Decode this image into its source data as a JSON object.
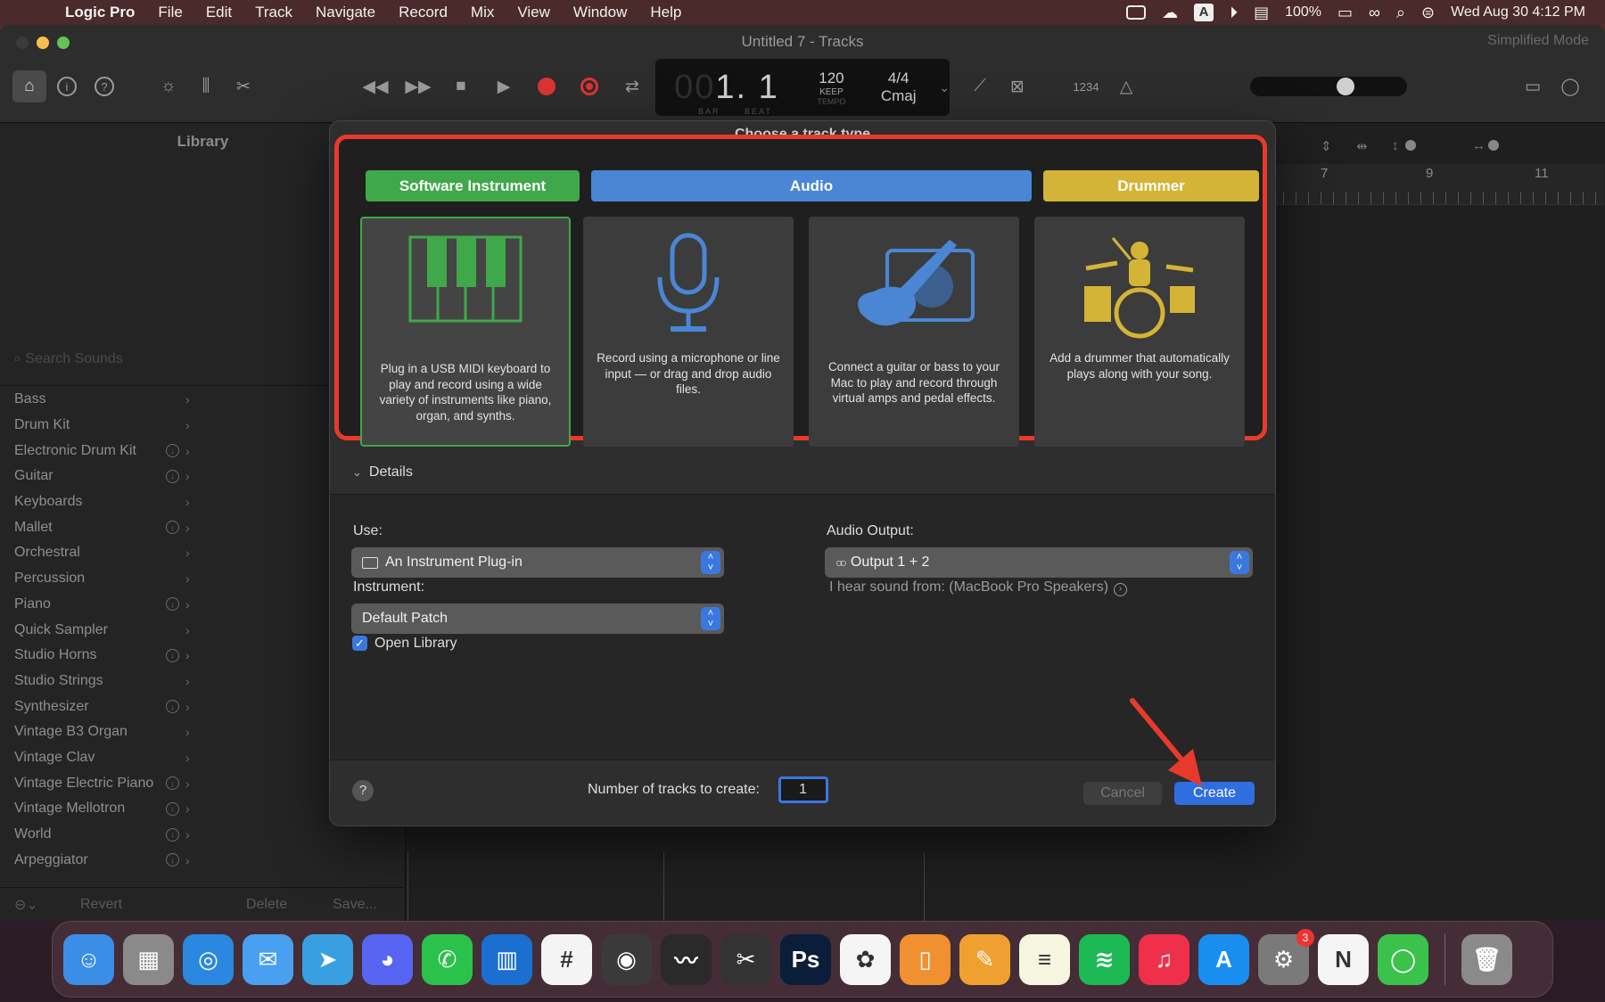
{
  "menubar": {
    "app_name": "Logic Pro",
    "items": [
      "File",
      "Edit",
      "Track",
      "Navigate",
      "Record",
      "Mix",
      "View",
      "Window",
      "Help"
    ],
    "input_source": "A",
    "battery": "100%",
    "datetime": "Wed Aug 30  4:12 PM"
  },
  "window": {
    "title": "Untitled 7 - Tracks",
    "simplified_mode": "Simplified Mode"
  },
  "lcd": {
    "position_dim": "00",
    "position": "1. 1",
    "bar_label": "BAR",
    "beat_label": "BEAT",
    "tempo": "120",
    "tempo_mode": "KEEP",
    "tempo_label": "TEMPO",
    "time_signature": "4/4",
    "key": "Cmaj"
  },
  "toolbar": {
    "count_in": "1234",
    "master_volume": 0.62
  },
  "library": {
    "title": "Library",
    "search_placeholder": "Search Sounds",
    "items": [
      {
        "label": "Bass",
        "download": false
      },
      {
        "label": "Drum Kit",
        "download": false
      },
      {
        "label": "Electronic Drum Kit",
        "download": true
      },
      {
        "label": "Guitar",
        "download": true
      },
      {
        "label": "Keyboards",
        "download": false
      },
      {
        "label": "Mallet",
        "download": true
      },
      {
        "label": "Orchestral",
        "download": false
      },
      {
        "label": "Percussion",
        "download": false
      },
      {
        "label": "Piano",
        "download": true
      },
      {
        "label": "Quick Sampler",
        "download": false
      },
      {
        "label": "Studio Horns",
        "download": true
      },
      {
        "label": "Studio Strings",
        "download": false
      },
      {
        "label": "Synthesizer",
        "download": true
      },
      {
        "label": "Vintage B3 Organ",
        "download": false
      },
      {
        "label": "Vintage Clav",
        "download": false
      },
      {
        "label": "Vintage Electric Piano",
        "download": true
      },
      {
        "label": "Vintage Mellotron",
        "download": true
      },
      {
        "label": "World",
        "download": true
      },
      {
        "label": "Arpeggiator",
        "download": true
      }
    ],
    "footer": {
      "revert": "Revert",
      "delete": "Delete",
      "save": "Save..."
    }
  },
  "ruler": {
    "marks": [
      "7",
      "9",
      "11"
    ]
  },
  "dialog": {
    "title": "Choose a track type",
    "tabs": {
      "software_instrument": "Software Instrument",
      "audio": "Audio",
      "drummer": "Drummer"
    },
    "cards": {
      "software_instrument": "Plug in a USB MIDI keyboard to play and record using a wide variety of instruments like piano, organ, and synths.",
      "microphone": "Record using a microphone or line input — or drag and drop audio files.",
      "guitar": "Connect a guitar or bass to your Mac to play and record through virtual amps and pedal effects.",
      "drummer": "Add a drummer that automatically plays along with your song."
    },
    "details_label": "Details",
    "use_label": "Use:",
    "use_value": "An Instrument Plug-in",
    "instrument_label": "Instrument:",
    "instrument_value": "Default Patch",
    "open_library_label": "Open Library",
    "open_library_checked": true,
    "audio_output_label": "Audio Output:",
    "audio_output_value": "Output 1 + 2",
    "hear_sound": "I hear sound from: (MacBook Pro Speakers)",
    "num_tracks_label": "Number of tracks to create:",
    "num_tracks_value": "1",
    "cancel_label": "Cancel",
    "create_label": "Create"
  },
  "colors": {
    "software_instrument": "#3fa84a",
    "audio": "#4a86d4",
    "drummer": "#d4b436",
    "highlight": "#e83a2c",
    "accent": "#2f6ee0"
  },
  "dock": {
    "items": [
      {
        "name": "Finder",
        "glyph": "☺",
        "color": "#3a8ee6"
      },
      {
        "name": "Launchpad",
        "glyph": "▦",
        "color": "#8a8a8a"
      },
      {
        "name": "Safari",
        "glyph": "◎",
        "color": "#2a88e0"
      },
      {
        "name": "Mail",
        "glyph": "✉",
        "color": "#4aa0f0"
      },
      {
        "name": "Telegram",
        "glyph": "➤",
        "color": "#38a0e0"
      },
      {
        "name": "Discord",
        "glyph": "◕",
        "color": "#5865f2"
      },
      {
        "name": "WhatsApp",
        "glyph": "✆",
        "color": "#2ac24a"
      },
      {
        "name": "Trello",
        "glyph": "▥",
        "color": "#1a6fd0"
      },
      {
        "name": "Slack",
        "glyph": "#",
        "color": "#f4f4f4"
      },
      {
        "name": "Logic Pro",
        "glyph": "◉",
        "color": "#3a3a3a"
      },
      {
        "name": "Waveform",
        "glyph": "〰",
        "color": "#2a2a2a"
      },
      {
        "name": "Final Cut Pro",
        "glyph": "✂",
        "color": "#333"
      },
      {
        "name": "Photoshop",
        "glyph": "Ps",
        "color": "#0a1e3a"
      },
      {
        "name": "Photos",
        "glyph": "✿",
        "color": "#f5f5f5"
      },
      {
        "name": "Books",
        "glyph": "▯",
        "color": "#f09030"
      },
      {
        "name": "Pages",
        "glyph": "✎",
        "color": "#f0a030"
      },
      {
        "name": "Notes",
        "glyph": "≡",
        "color": "#f5f5e0"
      },
      {
        "name": "Spotify",
        "glyph": "≋",
        "color": "#1db954"
      },
      {
        "name": "Music",
        "glyph": "♫",
        "color": "#f0304a"
      },
      {
        "name": "App Store",
        "glyph": "A",
        "color": "#1a8ef0"
      },
      {
        "name": "System Settings",
        "glyph": "⚙",
        "color": "#7a7a7a",
        "badge": "3"
      },
      {
        "name": "Notion",
        "glyph": "N",
        "color": "#f5f5f5"
      },
      {
        "name": "Messages",
        "glyph": "◯",
        "color": "#3ac24a"
      }
    ]
  }
}
